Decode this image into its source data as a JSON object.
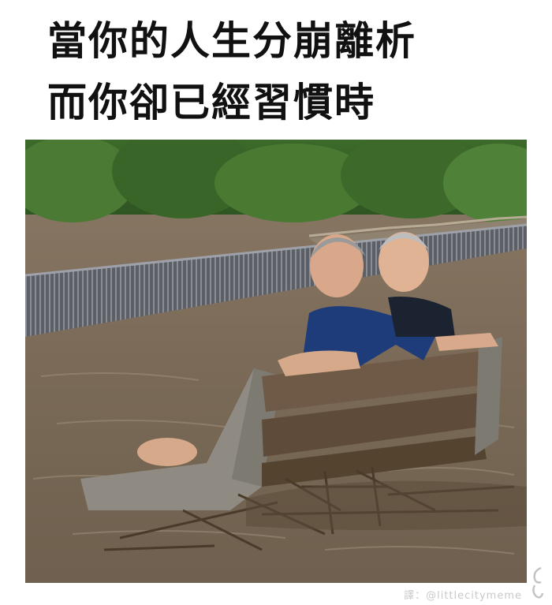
{
  "caption": {
    "line1": "當你的人生分崩離析",
    "line2": "而你卻已經習慣時"
  },
  "credit": {
    "text": "譯：@littlecitymeme"
  },
  "colors": {
    "text": "#111111",
    "floodwater": "#7d6c5a",
    "foliage": "#3f6a2c",
    "credit": "#c9c9c9"
  }
}
